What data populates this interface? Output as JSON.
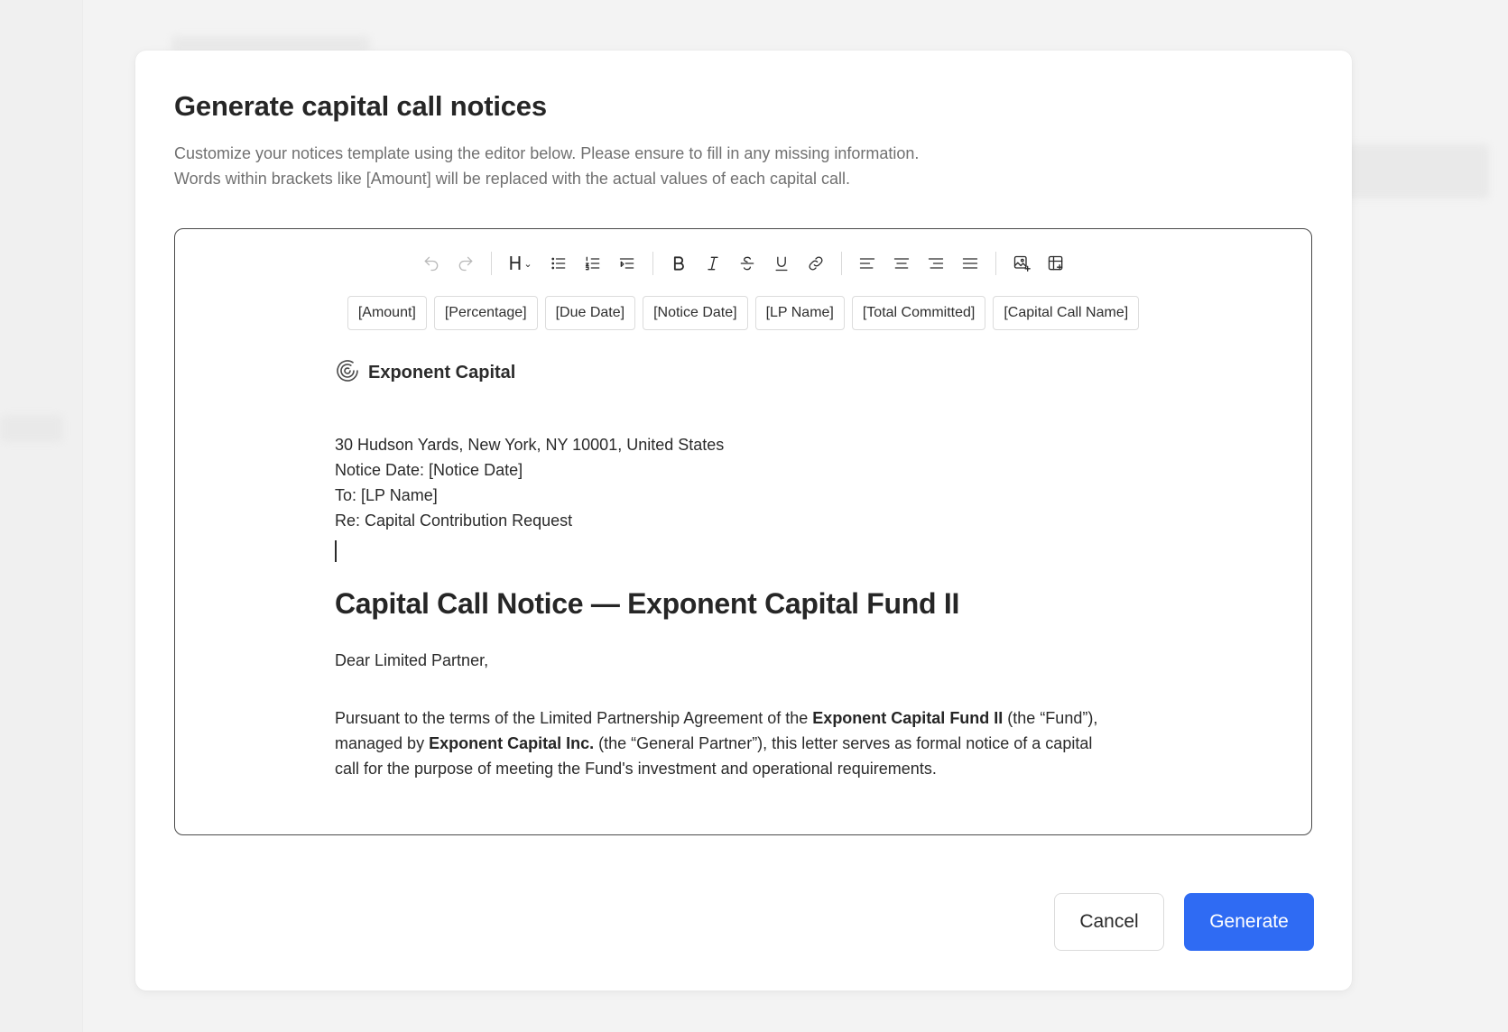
{
  "modal": {
    "title": "Generate capital call notices",
    "description_line1": "Customize your notices template using the editor below. Please ensure to fill in any missing information.",
    "description_line2": "Words within brackets like [Amount] will be replaced with the actual values of each capital call."
  },
  "toolbar": {
    "heading_label": "H",
    "icons": [
      "undo-icon",
      "redo-icon",
      "heading-dropdown",
      "bullet-list-icon",
      "ordered-list-icon",
      "indent-list-icon",
      "bold-icon",
      "italic-icon",
      "strikethrough-icon",
      "underline-icon",
      "link-icon",
      "align-left-icon",
      "align-center-icon",
      "align-right-icon",
      "align-justify-icon",
      "insert-image-icon",
      "insert-table-icon"
    ]
  },
  "placeholders": [
    "[Amount]",
    "[Percentage]",
    "[Due Date]",
    "[Notice Date]",
    "[LP Name]",
    "[Total Committed]",
    "[Capital Call Name]"
  ],
  "document": {
    "brand_name": "Exponent Capital",
    "address": "30 Hudson Yards, New York, NY 10001, United States",
    "notice_date": "Notice Date:  [Notice Date]",
    "to": "To:  [LP Name]",
    "re": "Re: Capital Contribution Request",
    "heading": "Capital Call Notice — Exponent Capital Fund II",
    "salutation": "Dear Limited Partner,",
    "para_1": "Pursuant to the terms of the Limited Partnership Agreement of the ",
    "para_bold_1": "Exponent Capital Fund II",
    "para_2": " (the “Fund”), managed by ",
    "para_bold_2": "Exponent Capital Inc.",
    "para_3": " (the “General Partner”), this letter serves as formal notice of a capital call for the purpose of meeting the Fund's investment and operational requirements."
  },
  "actions": {
    "cancel_label": "Cancel",
    "generate_label": "Generate"
  },
  "colors": {
    "primary": "#2f6bf3",
    "text": "#262626",
    "muted": "#707070",
    "border": "#dcdcdc"
  }
}
